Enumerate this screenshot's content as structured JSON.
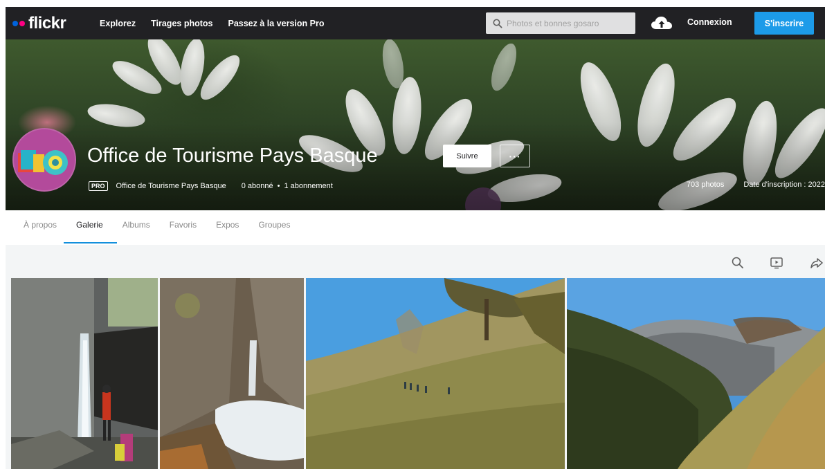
{
  "header": {
    "logo": "flickr",
    "nav": [
      "Explorez",
      "Tirages photos",
      "Passez à la version Pro"
    ],
    "search_placeholder": "Photos et bonnes gosaro",
    "login": "Connexion",
    "signup": "S'inscrire",
    "colors": {
      "bar": "#212124",
      "blue_dot": "#0063dc",
      "pink_dot": "#ff0084",
      "signup": "#1c9be9"
    }
  },
  "profile": {
    "name": "Office de Tourisme Pays Basque",
    "follow": "Suivre",
    "more": "···",
    "badge": "PRO",
    "username": "Office de Tourisme Pays Basque",
    "followers": "0 abonné",
    "following": "1 abonnement",
    "photos": "703 photos",
    "joined": "Date d'inscription : 2022"
  },
  "tabs": [
    {
      "label": "À propos",
      "active": false
    },
    {
      "label": "Galerie",
      "active": true
    },
    {
      "label": "Albums",
      "active": false
    },
    {
      "label": "Favoris",
      "active": false
    },
    {
      "label": "Expos",
      "active": false
    },
    {
      "label": "Groupes",
      "active": false
    }
  ],
  "toolbar": {
    "icons": [
      "search-icon",
      "slideshow-icon",
      "share-icon"
    ]
  },
  "gallery": {
    "photos": [
      {
        "subject": "waterfall-gorge-hiker"
      },
      {
        "subject": "waterfall-rocky-gorge"
      },
      {
        "subject": "hillside-hikers-tree"
      },
      {
        "subject": "mountain-valley-autumn"
      }
    ]
  }
}
